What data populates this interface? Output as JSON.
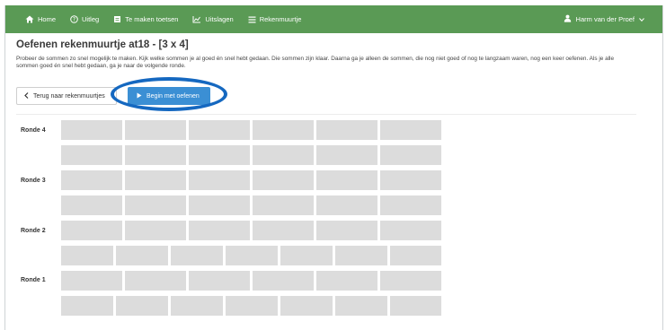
{
  "nav": {
    "items": [
      {
        "label": "Home",
        "icon": "home-icon"
      },
      {
        "label": "Uitleg",
        "icon": "help-circle-icon"
      },
      {
        "label": "Te maken toetsen",
        "icon": "document-icon"
      },
      {
        "label": "Uitslagen",
        "icon": "chart-icon"
      },
      {
        "label": "Rekenmuurtje",
        "icon": "menu-icon"
      }
    ],
    "user": {
      "label": "Harm van der Proef",
      "icon": "user-icon"
    }
  },
  "page": {
    "title": "Oefenen rekenmuurtje at18 - [3 x 4]",
    "intro": "Probeer de sommen zo snel mogelijk te maken. Kijk welke sommen je al goed én snel hebt gedaan. Die sommen zijn klaar. Daarna ga je alleen de sommen, die nog niet goed of nog te langzaam waren, nog een keer oefenen. Als je alle sommen goed én snel hebt gedaan, ga je naar de volgende ronde."
  },
  "buttons": {
    "back": "Terug naar rekenmuurtjes",
    "begin": "Begin met oefenen"
  },
  "colors": {
    "navbar": "#5a9a55",
    "primary": "#3b8fd4",
    "highlight": "#1568c0",
    "cell": "#dcdcdc"
  },
  "rondes": [
    {
      "label": "Ronde 4"
    },
    {
      "label": "Ronde 3"
    },
    {
      "label": "Ronde 2"
    },
    {
      "label": "Ronde 1"
    }
  ]
}
